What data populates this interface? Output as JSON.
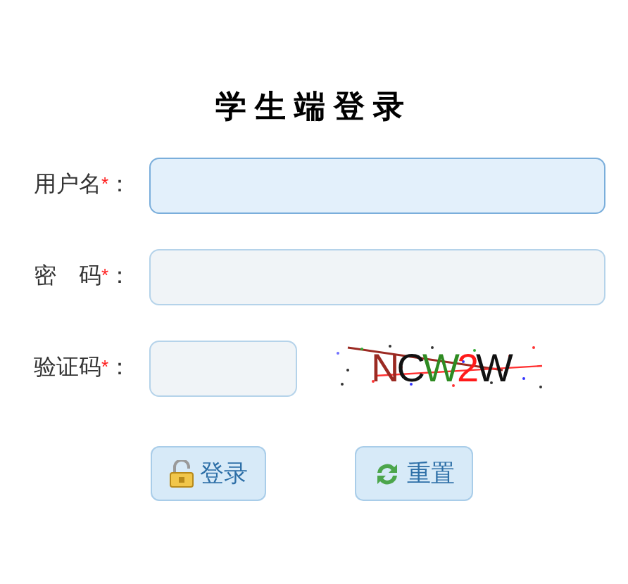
{
  "title": "学生端登录",
  "fields": [
    {
      "label": "用户名",
      "required_mark": "*",
      "colon": "：",
      "focused": true,
      "kind": "text"
    },
    {
      "label": "密　码",
      "required_mark": "*",
      "colon": "：",
      "focused": false,
      "kind": "password"
    },
    {
      "label": "验证码",
      "required_mark": "*",
      "colon": "：",
      "focused": false,
      "kind": "captcha"
    }
  ],
  "captcha": {
    "characters": [
      {
        "char": "N",
        "color": "#9b2a22"
      },
      {
        "char": "C",
        "color": "#111111"
      },
      {
        "char": "W",
        "color": "#2e8b22"
      },
      {
        "char": "2",
        "color": "#ff1a1a"
      },
      {
        "char": "W",
        "color": "#111111"
      }
    ]
  },
  "buttons": [
    {
      "label": "登录",
      "kind": "login"
    },
    {
      "label": "重置",
      "kind": "reset"
    }
  ]
}
